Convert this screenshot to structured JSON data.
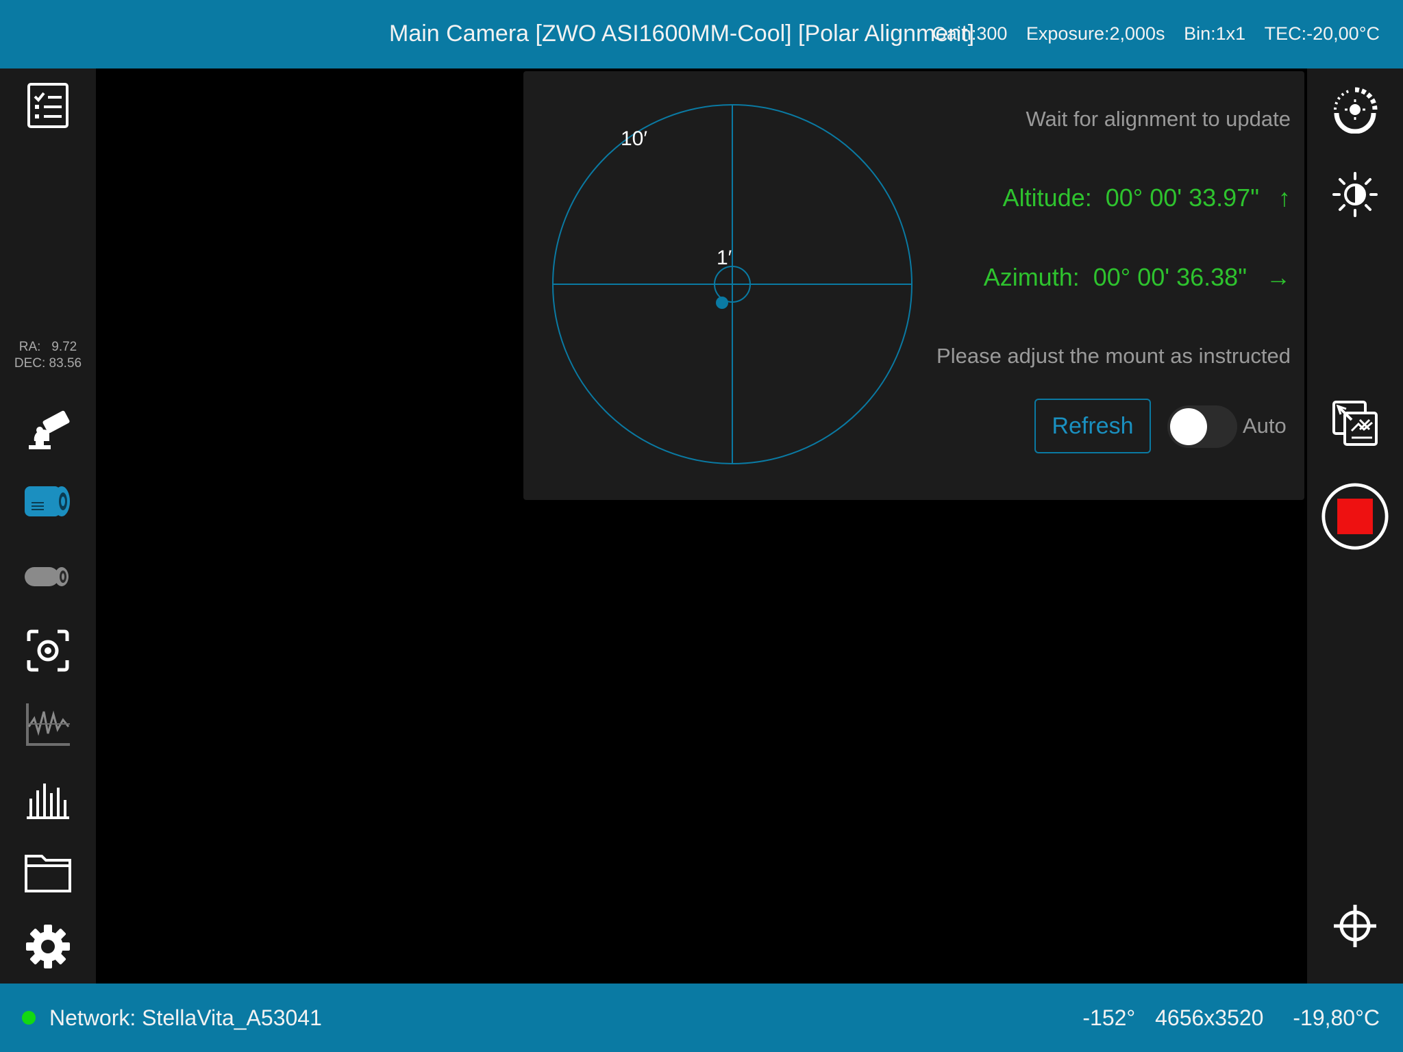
{
  "header": {
    "camera_title": "Main Camera [ZWO ASI1600MM-Cool] [Polar Alignment]",
    "gain": "Gain:300",
    "exposure": "Exposure:2,000s",
    "bin": "Bin:1x1",
    "tec": "TEC:-20,00°C"
  },
  "sidebar_left": {
    "ra": "RA:   9.72",
    "dec": "DEC: 83.56",
    "icons": [
      "checklist-icon",
      "telescope-mount-icon",
      "main-camera-icon",
      "guide-camera-icon",
      "focus-icon",
      "guiding-graph-icon",
      "histogram-icon",
      "folder-icon",
      "settings-icon"
    ]
  },
  "sidebar_right": {
    "icons": [
      "dew-heater-icon",
      "brightness-icon",
      "image-overlay-icon",
      "stop-capture-icon",
      "crosshair-icon"
    ]
  },
  "polar_panel": {
    "outer_ring_label": "10′",
    "inner_ring_label": "1′",
    "wait_text": "Wait for alignment to update",
    "altitude_label": "Altitude:",
    "altitude_value": "00° 00' 33.97\"",
    "altitude_arrow": "↑",
    "azimuth_label": "Azimuth:",
    "azimuth_value": "00° 00' 36.38\"",
    "azimuth_arrow": "→",
    "instruction": "Please adjust the mount as instructed",
    "refresh_label": "Refresh",
    "auto_label": "Auto",
    "auto_enabled": false
  },
  "status_bar": {
    "network": "Network: StellaVita_A53041",
    "angle": "-152°",
    "resolution": "4656x3520",
    "temperature": "-19,80°C"
  },
  "colors": {
    "accent": "#0a7aa3",
    "ok_green": "#2ec32e",
    "stop_red": "#ee1111"
  }
}
